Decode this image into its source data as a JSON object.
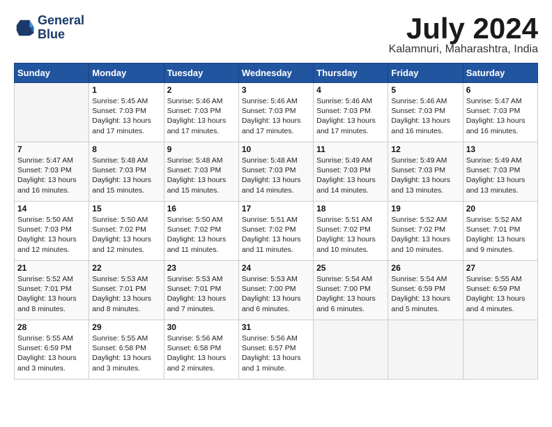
{
  "header": {
    "logo": {
      "line1": "General",
      "line2": "Blue"
    },
    "title": "July 2024",
    "location": "Kalamnuri, Maharashtra, India"
  },
  "columns": [
    "Sunday",
    "Monday",
    "Tuesday",
    "Wednesday",
    "Thursday",
    "Friday",
    "Saturday"
  ],
  "weeks": [
    [
      {
        "day": "",
        "info": ""
      },
      {
        "day": "1",
        "info": "Sunrise: 5:45 AM\nSunset: 7:03 PM\nDaylight: 13 hours\nand 17 minutes."
      },
      {
        "day": "2",
        "info": "Sunrise: 5:46 AM\nSunset: 7:03 PM\nDaylight: 13 hours\nand 17 minutes."
      },
      {
        "day": "3",
        "info": "Sunrise: 5:46 AM\nSunset: 7:03 PM\nDaylight: 13 hours\nand 17 minutes."
      },
      {
        "day": "4",
        "info": "Sunrise: 5:46 AM\nSunset: 7:03 PM\nDaylight: 13 hours\nand 17 minutes."
      },
      {
        "day": "5",
        "info": "Sunrise: 5:46 AM\nSunset: 7:03 PM\nDaylight: 13 hours\nand 16 minutes."
      },
      {
        "day": "6",
        "info": "Sunrise: 5:47 AM\nSunset: 7:03 PM\nDaylight: 13 hours\nand 16 minutes."
      }
    ],
    [
      {
        "day": "7",
        "info": "Sunrise: 5:47 AM\nSunset: 7:03 PM\nDaylight: 13 hours\nand 16 minutes."
      },
      {
        "day": "8",
        "info": "Sunrise: 5:48 AM\nSunset: 7:03 PM\nDaylight: 13 hours\nand 15 minutes."
      },
      {
        "day": "9",
        "info": "Sunrise: 5:48 AM\nSunset: 7:03 PM\nDaylight: 13 hours\nand 15 minutes."
      },
      {
        "day": "10",
        "info": "Sunrise: 5:48 AM\nSunset: 7:03 PM\nDaylight: 13 hours\nand 14 minutes."
      },
      {
        "day": "11",
        "info": "Sunrise: 5:49 AM\nSunset: 7:03 PM\nDaylight: 13 hours\nand 14 minutes."
      },
      {
        "day": "12",
        "info": "Sunrise: 5:49 AM\nSunset: 7:03 PM\nDaylight: 13 hours\nand 13 minutes."
      },
      {
        "day": "13",
        "info": "Sunrise: 5:49 AM\nSunset: 7:03 PM\nDaylight: 13 hours\nand 13 minutes."
      }
    ],
    [
      {
        "day": "14",
        "info": "Sunrise: 5:50 AM\nSunset: 7:03 PM\nDaylight: 13 hours\nand 12 minutes."
      },
      {
        "day": "15",
        "info": "Sunrise: 5:50 AM\nSunset: 7:02 PM\nDaylight: 13 hours\nand 12 minutes."
      },
      {
        "day": "16",
        "info": "Sunrise: 5:50 AM\nSunset: 7:02 PM\nDaylight: 13 hours\nand 11 minutes."
      },
      {
        "day": "17",
        "info": "Sunrise: 5:51 AM\nSunset: 7:02 PM\nDaylight: 13 hours\nand 11 minutes."
      },
      {
        "day": "18",
        "info": "Sunrise: 5:51 AM\nSunset: 7:02 PM\nDaylight: 13 hours\nand 10 minutes."
      },
      {
        "day": "19",
        "info": "Sunrise: 5:52 AM\nSunset: 7:02 PM\nDaylight: 13 hours\nand 10 minutes."
      },
      {
        "day": "20",
        "info": "Sunrise: 5:52 AM\nSunset: 7:01 PM\nDaylight: 13 hours\nand 9 minutes."
      }
    ],
    [
      {
        "day": "21",
        "info": "Sunrise: 5:52 AM\nSunset: 7:01 PM\nDaylight: 13 hours\nand 8 minutes."
      },
      {
        "day": "22",
        "info": "Sunrise: 5:53 AM\nSunset: 7:01 PM\nDaylight: 13 hours\nand 8 minutes."
      },
      {
        "day": "23",
        "info": "Sunrise: 5:53 AM\nSunset: 7:01 PM\nDaylight: 13 hours\nand 7 minutes."
      },
      {
        "day": "24",
        "info": "Sunrise: 5:53 AM\nSunset: 7:00 PM\nDaylight: 13 hours\nand 6 minutes."
      },
      {
        "day": "25",
        "info": "Sunrise: 5:54 AM\nSunset: 7:00 PM\nDaylight: 13 hours\nand 6 minutes."
      },
      {
        "day": "26",
        "info": "Sunrise: 5:54 AM\nSunset: 6:59 PM\nDaylight: 13 hours\nand 5 minutes."
      },
      {
        "day": "27",
        "info": "Sunrise: 5:55 AM\nSunset: 6:59 PM\nDaylight: 13 hours\nand 4 minutes."
      }
    ],
    [
      {
        "day": "28",
        "info": "Sunrise: 5:55 AM\nSunset: 6:59 PM\nDaylight: 13 hours\nand 3 minutes."
      },
      {
        "day": "29",
        "info": "Sunrise: 5:55 AM\nSunset: 6:58 PM\nDaylight: 13 hours\nand 3 minutes."
      },
      {
        "day": "30",
        "info": "Sunrise: 5:56 AM\nSunset: 6:58 PM\nDaylight: 13 hours\nand 2 minutes."
      },
      {
        "day": "31",
        "info": "Sunrise: 5:56 AM\nSunset: 6:57 PM\nDaylight: 13 hours\nand 1 minute."
      },
      {
        "day": "",
        "info": ""
      },
      {
        "day": "",
        "info": ""
      },
      {
        "day": "",
        "info": ""
      }
    ]
  ]
}
